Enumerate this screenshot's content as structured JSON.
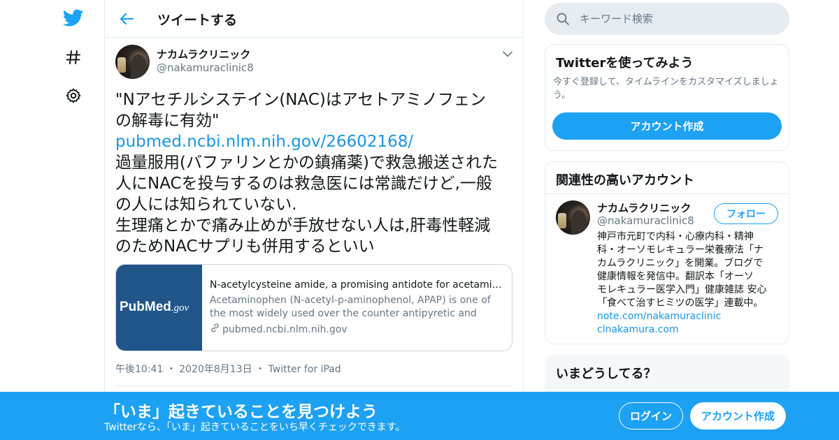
{
  "colors": {
    "brand": "#1da1f2",
    "link": "#1b95e0",
    "muted": "#657786",
    "border": "#e6ecf0"
  },
  "nav": {
    "items": [
      {
        "name": "twitter-logo-icon"
      },
      {
        "name": "hashtag-icon"
      },
      {
        "name": "gear-icon"
      }
    ]
  },
  "header": {
    "title": "ツイートする"
  },
  "tweet": {
    "author_name": "ナカムラクリニック",
    "author_handle": "@nakamuraclinic8",
    "lines": [
      "\"Nアセチルシステイン(NAC)はアセトアミノフェン",
      "の解毒に有効\""
    ],
    "link": "pubmed.ncbi.nlm.nih.gov/26602168/",
    "body_lines": [
      "過量服用(バファリンとかの鎮痛薬)で救急搬送された",
      "人にNACを投与するのは救急医には常識だけど,一般",
      "の人には知られていない.",
      "生理痛とかで痛み止めが手放せない人は,肝毒性軽減",
      "のためNACサプリも併用するといい"
    ],
    "card": {
      "logo_main": "PubMed",
      "logo_suffix": ".gov",
      "title": "N-acetylcysteine amide, a promising antidote for acetaminophen toxicity",
      "description": "Acetaminophen (N-acetyl-p-aminophenol, APAP) is one of the most widely used over the counter antipyretic and analgesic medications",
      "url": "pubmed.ncbi.nlm.nih.gov"
    },
    "time": "午後10:41",
    "date": "2020年8月13日",
    "source": "Twitter for iPad"
  },
  "sidebar": {
    "search_placeholder": "キーワード検索",
    "signup_panel": {
      "title": "Twitterを使ってみよう",
      "text": "今すぐ登録して、タイムラインをカスタマイズしましょう。",
      "button": "アカウント作成"
    },
    "related": {
      "title": "関連性の高いアカウント",
      "name": "ナカムラクリニック",
      "handle": "@nakamuraclinic8",
      "follow": "フォロー",
      "bio_lines": [
        "神戸市元町で内科・心療内科・精神",
        "科・オーソモレキュラー栄養療法「ナ",
        "カムラクリニック」を開業。ブログで",
        "健康情報を発信中。翻訳本「オーソ",
        "モレキュラー医学入門」健康雑誌 安心",
        "「食べて治すヒミツの医学」連載中。"
      ],
      "links": [
        "note.com/nakamuraclinic",
        "clnakamura.com"
      ]
    },
    "trends": {
      "title": "いまどうしてる？"
    }
  },
  "bottom_bar": {
    "title": "「いま」起きていることを見つけよう",
    "subtitle": "Twitterなら、「いま」起きていることをいち早くチェックできます。",
    "login": "ログイン",
    "signup": "アカウント作成"
  }
}
